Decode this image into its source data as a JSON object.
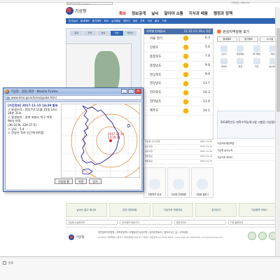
{
  "header": {
    "logo_text": "기상청",
    "top_badge": "대한민국기상청 [KOREA]",
    "top_links": "사이트맵 | ENGLISH",
    "nav": [
      "특보",
      "정보공개",
      "날씨",
      "알아야 소통",
      "지식과 배움",
      "행정과 정책"
    ],
    "subnav": [
      "전국날씨",
      "동네예보",
      "중기예보",
      "특보",
      "날씨해설",
      "레이더",
      "위성",
      "관측",
      "지진",
      "황사",
      "기후"
    ]
  },
  "left_tabs": [
    "동네",
    "지역",
    "날씨",
    "위성",
    "레이더"
  ],
  "forecast": {
    "title": "지역별 현재날씨",
    "time": "11.15 (수) 16시 기준",
    "rows": [
      {
        "name": "서울 경기",
        "temp": "6.3"
      },
      {
        "name": "강원도",
        "temp": "5.6"
      },
      {
        "name": "충청북도",
        "temp": "7.9"
      },
      {
        "name": "충청남도",
        "temp": "9.8"
      },
      {
        "name": "경상북도",
        "temp": "9.9"
      },
      {
        "name": "경상남도",
        "temp": "13.7"
      },
      {
        "name": "전라북도",
        "temp": "10.2"
      },
      {
        "name": "전라남도",
        "temp": "11.9"
      },
      {
        "name": "제주도",
        "temp": "14.1"
      }
    ]
  },
  "right": {
    "title": "관심지역설정 보기",
    "buttons": [
      "동네예보",
      "중기예보",
      "도시별"
    ],
    "icons": [
      "초단기",
      "동네예보",
      "중기예보",
      "특보",
      "레이더",
      "위성",
      "지진",
      "날씨해설"
    ],
    "banner": "2018학년도 대학수학능력시험 시험장 기상정보",
    "list": [
      "기상자료개방포털",
      "기상청 날씨누리",
      "기상기후 데이터"
    ]
  },
  "mid": {
    "news": [
      {
        "t": "기상청 소식 안내",
        "d": "2017.11.15"
      },
      {
        "t": "보도자료",
        "d": "2017.11.14"
      },
      {
        "t": "공지사항",
        "d": "2017.11.14"
      },
      {
        "t": "입찰정보",
        "d": "2017.11.13"
      },
      {
        "t": "채용정보",
        "d": "2017.11.13"
      }
    ],
    "cards": [
      "민원처리 안내",
      "기상청 인재채용",
      "기상청 블로그"
    ]
  },
  "banners": [
    "날씨는 알고 떠나요",
    "지진 대피요령",
    "기상기후 빅데이터",
    "공익신고",
    "기상정보 서비스"
  ],
  "linkbar": [
    "기상청 소셜미디어",
    "주요정보 바로가기",
    "관련사이트",
    "기관 홈페이지"
  ],
  "footer": {
    "name": "기상청",
    "links": "개인정보처리방침 | 저작권정책 | 이메일무단수집거부 | 뷰어다운로드 | 찾아오시는 길 | 사이트맵",
    "address": "(07062) 서울특별시 동작구 여의대방로16길 61 기상청 / 대표전화 02-2181-0900 / Copyright (C) 2008 KMA. All Rights Reserved."
  },
  "statusbar": "완료",
  "popup": {
    "title": "기상청 : 알림 화면 - Mozilla Firefox",
    "url": "www.kma.go.kr/kma/quake.html",
    "heading": "[지진정보] 2017-11-15 14:29 발표",
    "lines": [
      "ㅇ 발생시각 : 2017년 11월 15일 14시",
      "  29분 31초",
      "ㅇ 발생위치 : 경북 포항시 북구 북쪽",
      "  9km 지역",
      "  (36.10 N, 129.37 E)",
      "ㅇ 규모 : 5.4",
      "ㅇ 진앙은 육지 인근에 위치함"
    ],
    "map_label1": "2017-11-15",
    "map_label2": "14:29:31",
    "buttons": [
      "기상청 홈",
      "이전",
      "닫기"
    ]
  }
}
